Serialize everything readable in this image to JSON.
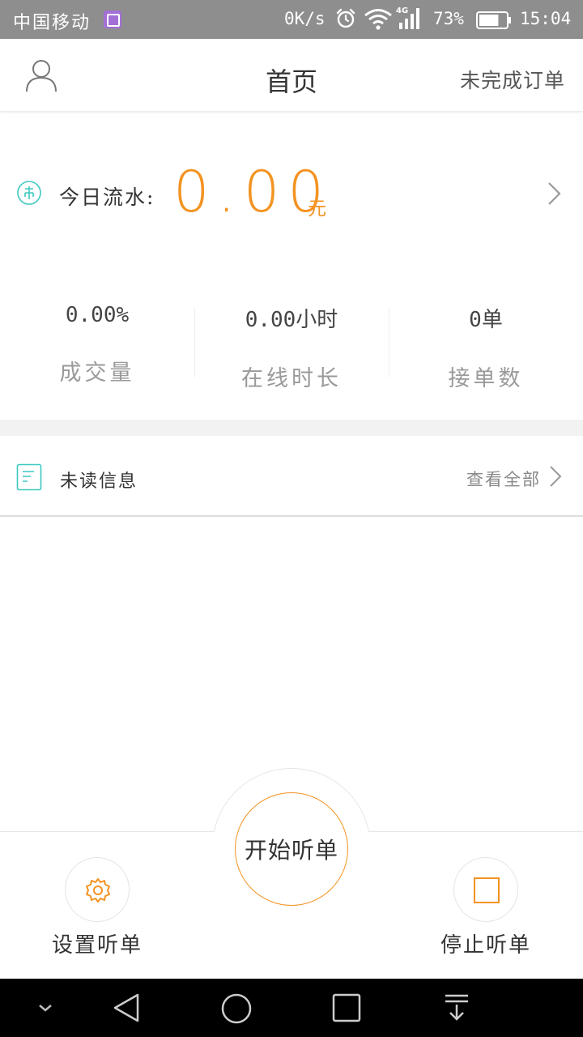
{
  "status_bar": {
    "carrier": "中国移动",
    "net_speed": "0K/s",
    "network_type": "4G",
    "battery_percent": "73%",
    "battery_level": 0.73,
    "time": "15:04"
  },
  "header": {
    "title": "首页",
    "right_link": "未完成订单",
    "left_icon": "user-icon"
  },
  "earnings": {
    "label": "今日流水:",
    "amount": "0.00",
    "unit": "元",
    "icon": "money-icon"
  },
  "stats": [
    {
      "value": "0.00%",
      "label": "成交量"
    },
    {
      "value": "0.00小时",
      "label": "在线时长"
    },
    {
      "value": "0单",
      "label": "接单数"
    }
  ],
  "unread": {
    "label": "未读信息",
    "view_all": "查看全部",
    "icon": "document-icon"
  },
  "actions": {
    "start": "开始听单",
    "settings": "设置听单",
    "stop": "停止听单"
  },
  "colors": {
    "accent": "#f39322",
    "teal_icon": "#3cc8c0",
    "status_bar": "#8e8e8e"
  }
}
